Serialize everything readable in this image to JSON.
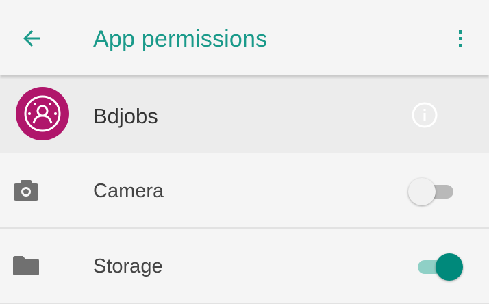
{
  "toolbar": {
    "title": "App permissions",
    "back_icon": "arrow-back-icon",
    "overflow_icon": "more-vert-icon",
    "accent_color": "#1a9a8a"
  },
  "app": {
    "name": "Bdjobs",
    "icon": "bdjobs-app-icon",
    "icon_color": "#b0166b",
    "info_icon": "info-icon"
  },
  "permissions": [
    {
      "label": "Camera",
      "icon": "camera-icon",
      "enabled": false
    },
    {
      "label": "Storage",
      "icon": "folder-icon",
      "enabled": true
    }
  ],
  "colors": {
    "switch_on_thumb": "#00897b",
    "switch_on_track": "#8fd0c6",
    "switch_off_track": "#b9b9b9"
  }
}
